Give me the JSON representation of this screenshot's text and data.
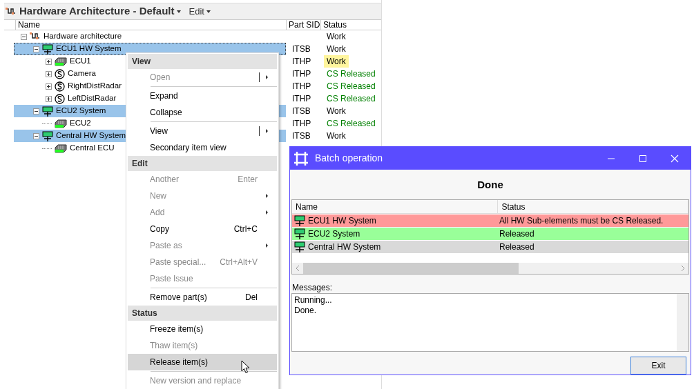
{
  "window": {
    "title": "Hardware Architecture - Default",
    "menu": "Edit"
  },
  "tree": {
    "columns": [
      "Name",
      "Part SID",
      "Status"
    ],
    "items": [
      {
        "name": "Hardware architecture",
        "kind": "architecture",
        "status": "Work",
        "color": "#000000",
        "status_highlighted": false,
        "selected": false,
        "focused": false,
        "expanded": true,
        "children": [
          {
            "name": "ECU1 HW System",
            "kind": "system",
            "part_sid": "ITSB",
            "status": "Work",
            "color": "#000000",
            "status_highlighted": false,
            "selected": true,
            "focused": true,
            "expanded": true,
            "children": [
              {
                "name": "ECU1",
                "kind": "ecu",
                "part_sid": "ITHP",
                "status": "Work",
                "color": "#000000",
                "status_highlighted": true,
                "selected": false,
                "focused": false,
                "expanded": false
              },
              {
                "name": "Camera",
                "kind": "sensor",
                "part_sid": "ITHP",
                "status": "CS Released",
                "color": "#008000",
                "status_highlighted": false,
                "selected": false,
                "focused": false,
                "expanded": false
              },
              {
                "name": "RightDistRadar",
                "kind": "sensor",
                "part_sid": "ITHP",
                "status": "CS Released",
                "color": "#008000",
                "status_highlighted": false,
                "selected": false,
                "focused": false,
                "expanded": false
              },
              {
                "name": "LeftDistRadar",
                "kind": "sensor",
                "part_sid": "ITHP",
                "status": "CS Released",
                "color": "#008000",
                "status_highlighted": false,
                "selected": false,
                "focused": false,
                "expanded": false
              }
            ]
          },
          {
            "name": "ECU2 System",
            "kind": "system",
            "part_sid": "ITSB",
            "status": "Work",
            "color": "#000000",
            "status_highlighted": false,
            "selected": true,
            "focused": false,
            "expanded": true,
            "children": [
              {
                "name": "ECU2",
                "kind": "ecu",
                "part_sid": "ITHP",
                "status": "CS Released",
                "color": "#008000",
                "status_highlighted": false,
                "selected": false,
                "focused": false
              }
            ]
          },
          {
            "name": "Central HW System",
            "kind": "system",
            "part_sid": "ITSB",
            "status": "Work",
            "color": "#000000",
            "status_highlighted": false,
            "selected": true,
            "focused": false,
            "expanded": true,
            "children": [
              {
                "name": "Central ECU",
                "kind": "ecu",
                "selected": false,
                "focused": false
              }
            ]
          }
        ]
      }
    ]
  },
  "context_menu": {
    "sections": [
      {
        "title": "View",
        "items": [
          {
            "label": "Open",
            "kind": "split-submenu",
            "disabled": true,
            "selected": false,
            "separator_before": false
          },
          {
            "label": "Expand",
            "disabled": false,
            "selected": false,
            "separator_before": true
          },
          {
            "label": "Collapse",
            "disabled": false,
            "selected": false,
            "separator_before": false
          },
          {
            "label": "View",
            "kind": "split-submenu",
            "disabled": false,
            "selected": false,
            "separator_before": true
          },
          {
            "label": "Secondary item view",
            "disabled": false,
            "selected": false,
            "separator_before": false
          }
        ]
      },
      {
        "title": "Edit",
        "items": [
          {
            "label": "Another",
            "shortcut": "Enter",
            "disabled": true,
            "selected": false,
            "separator_before": false
          },
          {
            "label": "New",
            "kind": "submenu",
            "disabled": true,
            "selected": false,
            "separator_before": false
          },
          {
            "label": "Add",
            "kind": "submenu",
            "disabled": true,
            "selected": false,
            "separator_before": false
          },
          {
            "label": "Copy",
            "shortcut": "Ctrl+C",
            "disabled": false,
            "selected": false,
            "separator_before": false
          },
          {
            "label": "Paste as",
            "kind": "submenu",
            "disabled": true,
            "selected": false,
            "separator_before": false
          },
          {
            "label": "Paste special...",
            "shortcut": "Ctrl+Alt+V",
            "disabled": true,
            "selected": false,
            "separator_before": false
          },
          {
            "label": "Paste Issue",
            "disabled": true,
            "selected": false,
            "separator_before": false
          },
          {
            "label": "Remove part(s)",
            "shortcut": "Del",
            "disabled": false,
            "selected": false,
            "separator_before": true
          }
        ]
      },
      {
        "title": "Status",
        "items": [
          {
            "label": "Freeze item(s)",
            "disabled": false,
            "selected": false,
            "separator_before": false
          },
          {
            "label": "Thaw item(s)",
            "disabled": true,
            "selected": false,
            "separator_before": false
          },
          {
            "label": "Release item(s)",
            "disabled": false,
            "selected": true,
            "separator_before": false
          },
          {
            "label": "New version and replace",
            "disabled": true,
            "selected": false,
            "separator_before": true
          }
        ]
      }
    ]
  },
  "dialog": {
    "title": "Batch operation",
    "heading": "Done",
    "columns": [
      "Name",
      "Status"
    ],
    "rows": [
      {
        "name": "ECU1 HW System",
        "status": "All HW Sub-elements must be CS Released.",
        "color": "#ff9999"
      },
      {
        "name": "ECU2 System",
        "status": "Released",
        "color": "#99ff99"
      },
      {
        "name": "Central HW System",
        "status": "Released",
        "color": "#d9d9d9"
      }
    ],
    "messages_label": "Messages:",
    "messages": [
      "Running...",
      "Done."
    ],
    "button": "Exit"
  }
}
